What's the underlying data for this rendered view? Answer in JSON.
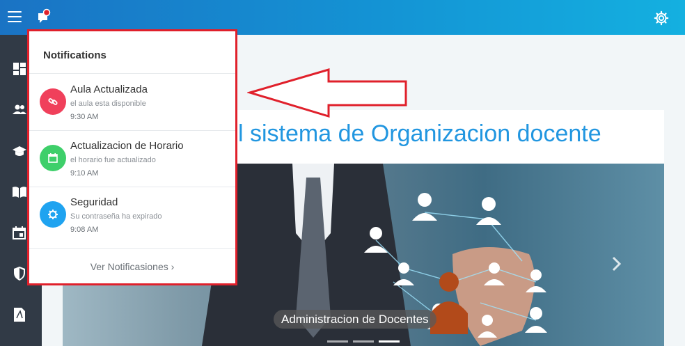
{
  "banner": {
    "title": "l sistema de Organizacion docente",
    "slide_caption": "Administracion de Docentes",
    "active_slide": 3,
    "slide_count": 3
  },
  "notifications": {
    "title": "Notifications",
    "items": [
      {
        "title": "Aula Actualizada",
        "text": "el aula esta disponible",
        "time": "9:30 AM",
        "icon": "link-icon",
        "color": "#f0405b"
      },
      {
        "title": "Actualizacion de Horario",
        "text": "el horario fue actualizado",
        "time": "9:10 AM",
        "icon": "calendar-icon",
        "color": "#3ecf6a"
      },
      {
        "title": "Seguridad",
        "text": "Su contraseña ha expirado",
        "time": "9:08 AM",
        "icon": "gear-icon",
        "color": "#1fa3f0"
      }
    ],
    "footer_label": "Ver Notificasiones ›"
  },
  "sidebar": {
    "icons": [
      "dashboard-icon",
      "users-icon",
      "graduation-cap-icon",
      "book-icon",
      "calendar-icon",
      "shield-icon",
      "pdf-icon"
    ]
  },
  "colors": {
    "topbar": "#1a8fd4",
    "sidebar": "#313a46",
    "accent": "#2196e0",
    "highlight": "#e0202b"
  }
}
